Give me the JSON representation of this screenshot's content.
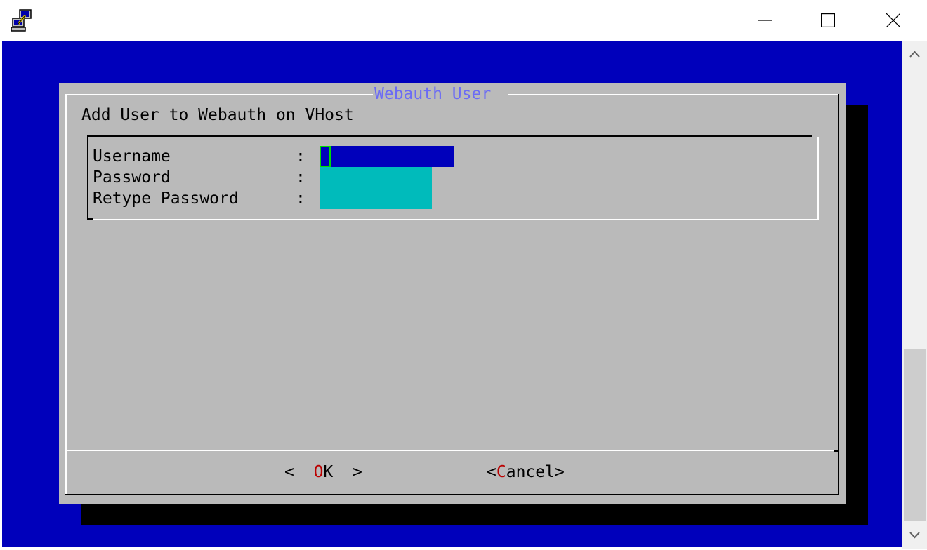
{
  "window": {
    "icon": "putty-icon",
    "controls": {
      "minimize": "minimize-icon",
      "maximize": "maximize-icon",
      "close": "close-icon"
    }
  },
  "dialog": {
    "title": "Webauth User",
    "heading": "Add User to Webauth on VHost",
    "fields": [
      {
        "label": "Username",
        "separator": ":",
        "value": ""
      },
      {
        "label": "Password",
        "separator": ":",
        "value": ""
      },
      {
        "label": "Retype Password",
        "separator": ":",
        "value": ""
      }
    ],
    "buttons": {
      "ok": {
        "open": "<",
        "hotkey": "O",
        "rest": "K",
        "close": ">"
      },
      "cancel": {
        "open": "<",
        "hotkey": "C",
        "rest": "ancel",
        "close": ">"
      }
    }
  },
  "colors": {
    "terminal_background": "#0000bb",
    "dialog_background": "#bababa",
    "title_text": "#6b6bf5",
    "active_input": "#0000bb",
    "inactive_input": "#00bbbb",
    "hotkey": "#bb0000"
  },
  "scrollbar": {
    "up": "chevron-up-icon",
    "down": "chevron-down-icon"
  }
}
